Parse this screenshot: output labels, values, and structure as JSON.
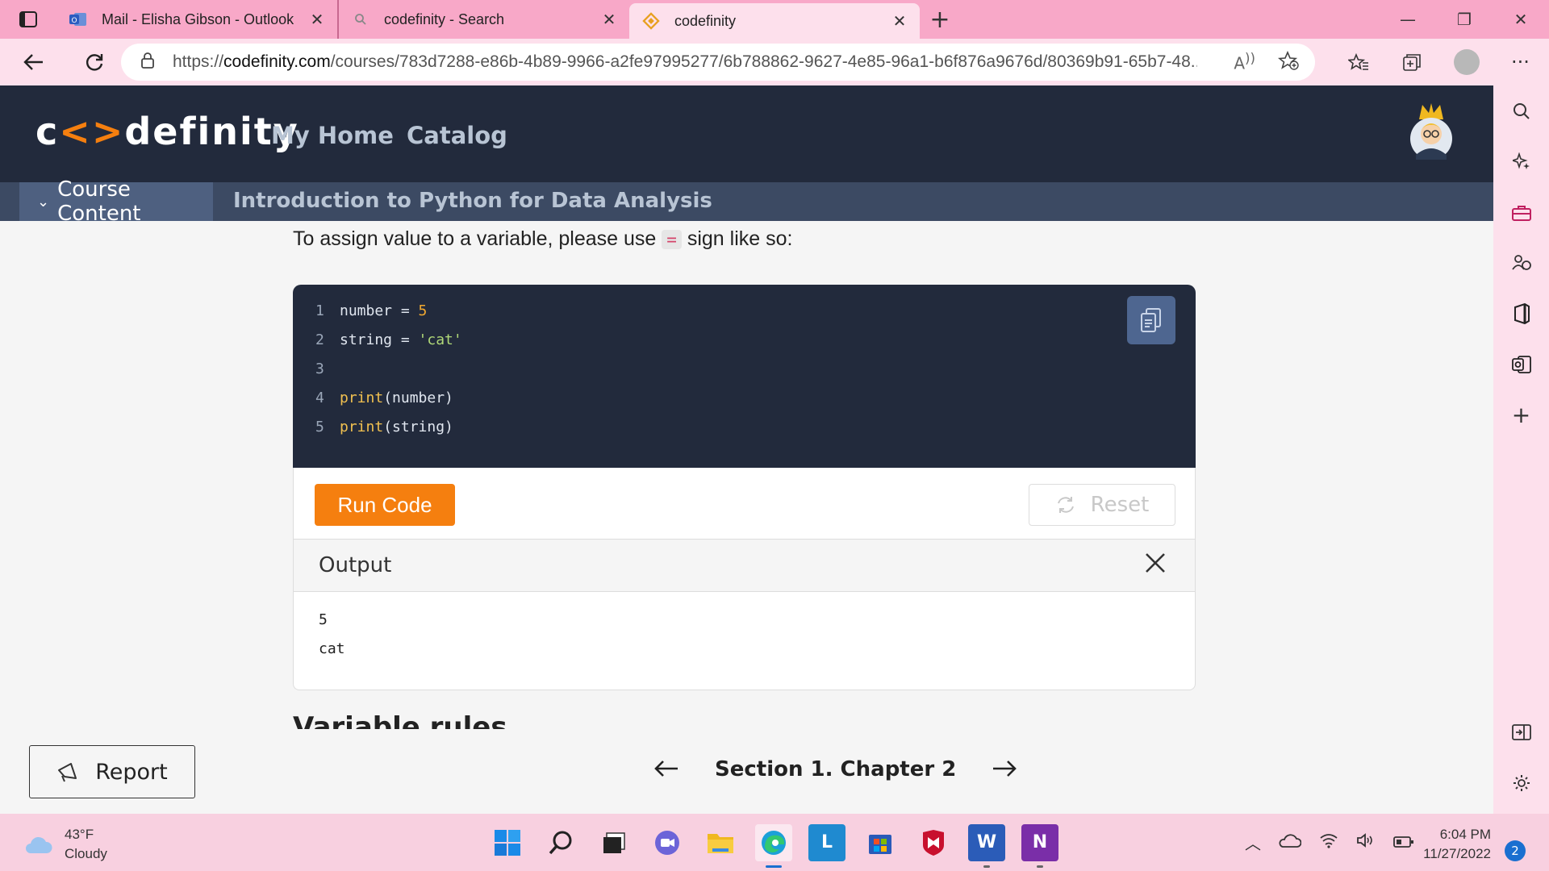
{
  "browser": {
    "tabs": [
      {
        "title": "Mail - Elisha Gibson - Outlook",
        "icon": "outlook-icon"
      },
      {
        "title": "codefinity - Search",
        "icon": "search-icon"
      },
      {
        "title": "codefinity",
        "icon": "codefinity-icon",
        "active": true
      }
    ],
    "url_prefix": "https://",
    "url_domain": "codefinity.com",
    "url_path": "/courses/783d7288-e86b-4b89-9966-a2fe97995277/6b788862-9627-4e85-96a1-b6f876a9676d/80369b91-65b7-48...",
    "new_tab": "+"
  },
  "site": {
    "logo_left": "c",
    "logo_accent": "<>",
    "logo_right": "definity",
    "nav": {
      "home": "My Home",
      "catalog": "Catalog"
    },
    "course_content_label": "Course Content",
    "course_title": "Introduction to Python for Data Analysis"
  },
  "lesson": {
    "lead_before": "To assign value to a variable, please use ",
    "lead_code": "=",
    "lead_after": " sign like so:",
    "code_lines": [
      {
        "n": "1",
        "text": "number = 5"
      },
      {
        "n": "2",
        "text": "string = 'cat'"
      },
      {
        "n": "3",
        "text": ""
      },
      {
        "n": "4",
        "text": "print(number)"
      },
      {
        "n": "5",
        "text": "print(string)"
      }
    ],
    "run_label": "Run Code",
    "reset_label": "Reset",
    "output_label": "Output",
    "output_lines": [
      "5",
      "cat"
    ],
    "next_heading": "Variable rules"
  },
  "footer": {
    "report_label": "Report",
    "chapter_label": "Section 1. Chapter 2"
  },
  "taskbar": {
    "temp": "43°F",
    "condition": "Cloudy",
    "time": "6:04 PM",
    "date": "11/27/2022",
    "notifications": "2"
  },
  "colors": {
    "accent": "#f57f0f",
    "header_bg": "#222a3c",
    "subheader_bg": "#3c4a63",
    "chrome_pink": "#f8a8c8"
  }
}
